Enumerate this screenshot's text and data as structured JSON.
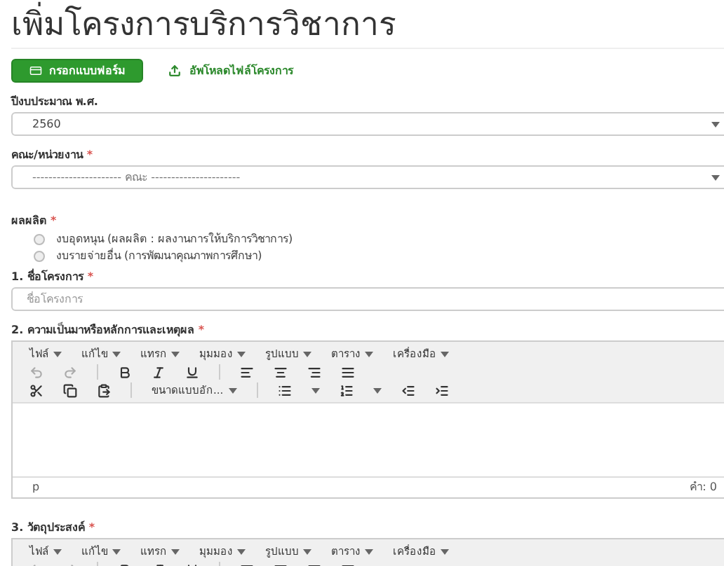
{
  "page": {
    "title": "เพิ่มโครงการบริการวิชาการ"
  },
  "actions": [
    {
      "kind": "button",
      "label": "กรอกแบบฟอร์ม"
    },
    {
      "kind": "link",
      "label": "อัพโหลดไฟล์โครงการ"
    }
  ],
  "fields": [
    {
      "kind": "select",
      "label": "ปีงบประมาณ พ.ศ.",
      "value": "2560"
    },
    {
      "kind": "select",
      "label": "คณะ/หน่วยงาน",
      "required_mark": "*",
      "value": "---------------------- คณะ ----------------------",
      "muted": true
    },
    {
      "kind": "radio",
      "label": "ผลผลิต",
      "required_mark": "*",
      "options": [
        {
          "label": "งบอุดหนุน (ผลผลิต : ผลงานการให้บริการวิชาการ)",
          "selected": false
        },
        {
          "label": "งบรายจ่ายอื่น (การพัฒนาคุณภาพการศึกษา)",
          "selected": false
        }
      ]
    },
    {
      "kind": "text",
      "label": "1. ชื่อโครงการ",
      "required_mark": "*",
      "placeholder": "ชื่อโครงการ"
    },
    {
      "kind": "editor",
      "label": "2. ความเป็นมาหรือหลักการและเหตุผล",
      "required_mark": "*",
      "menus": [
        "ไฟล์",
        "แก้ไข",
        "แทรก",
        "มุมมอง",
        "รูปแบบ",
        "ตาราง",
        "เครื่องมือ"
      ],
      "font_size": "ขนาดแบบอัก...",
      "path": "p",
      "word_count": "คำ: 0"
    },
    {
      "kind": "editor",
      "label": "3. วัตถุประสงค์",
      "required_mark": "*",
      "menus": [
        "ไฟล์",
        "แก้ไข",
        "แทรก",
        "มุมมอง",
        "รูปแบบ",
        "ตาราง",
        "เครื่องมือ"
      ]
    }
  ]
}
